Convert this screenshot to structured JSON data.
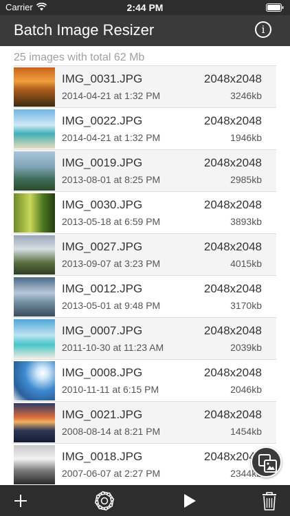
{
  "status": {
    "carrier": "Carrier",
    "time": "2:44 PM"
  },
  "nav": {
    "title": "Batch Image Resizer",
    "info_icon": "info-icon"
  },
  "summary": "25 images with total 62 Mb",
  "images": [
    {
      "name": "IMG_0031.JPG",
      "dims": "2048x2048",
      "date": "2014-04-21 at 1:32 PM",
      "size": "3246kb",
      "scene": "sunset field"
    },
    {
      "name": "IMG_0022.JPG",
      "dims": "2048x2048",
      "date": "2014-04-21 at 1:32 PM",
      "size": "1946kb",
      "scene": "tropical beach"
    },
    {
      "name": "IMG_0019.JPG",
      "dims": "2048x2048",
      "date": "2013-08-01 at 8:25 PM",
      "size": "2985kb",
      "scene": "mountain lake"
    },
    {
      "name": "IMG_0030.JPG",
      "dims": "2048x2048",
      "date": "2013-05-18 at 6:59 PM",
      "size": "3893kb",
      "scene": "green forest"
    },
    {
      "name": "IMG_0027.JPG",
      "dims": "2048x2048",
      "date": "2013-09-07 at 3:23 PM",
      "size": "4015kb",
      "scene": "mountain valley"
    },
    {
      "name": "IMG_0012.JPG",
      "dims": "2048x2048",
      "date": "2013-05-01 at 9:48 PM",
      "size": "3170kb",
      "scene": "stormy sea"
    },
    {
      "name": "IMG_0007.JPG",
      "dims": "2048x2048",
      "date": "2011-10-30 at 11:23 AM",
      "size": "2039kb",
      "scene": "turquoise beach"
    },
    {
      "name": "IMG_0008.JPG",
      "dims": "2048x2048",
      "date": "2010-11-11 at 6:15 PM",
      "size": "2046kb",
      "scene": "snowy sky"
    },
    {
      "name": "IMG_0021.JPG",
      "dims": "2048x2048",
      "date": "2008-08-14 at 8:21 PM",
      "size": "1454kb",
      "scene": "dusk lake"
    },
    {
      "name": "IMG_0018.JPG",
      "dims": "2048x2048",
      "date": "2007-06-07 at 2:27 PM",
      "size": "2344kb",
      "scene": "black and white path"
    }
  ],
  "toolbar": {
    "add_icon": "plus-icon",
    "settings_icon": "gear-icon",
    "run_icon": "play-icon",
    "delete_icon": "trash-icon"
  },
  "fab_icon": "image-resize-icon",
  "colors": {
    "bar": "#3a3a3a",
    "status_bar": "#2d2d2d",
    "summary_text": "#a0a0a0"
  }
}
